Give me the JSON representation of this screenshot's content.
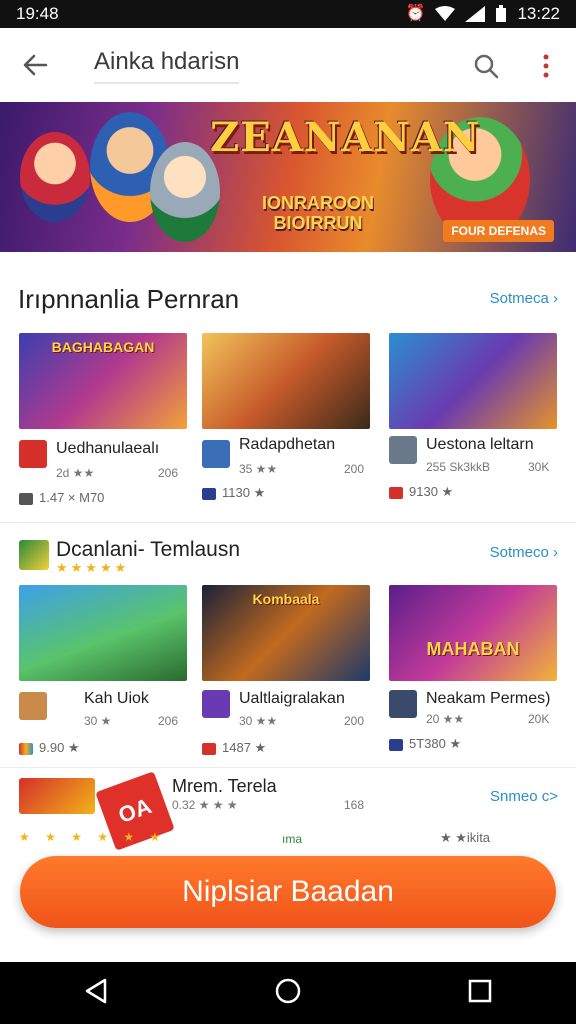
{
  "status_bar": {
    "time": "19:48",
    "right_time": "13:22"
  },
  "app_bar": {
    "title": "Ainka hdarisn"
  },
  "banner": {
    "title": "ZEANANAN",
    "subtitle_line1": "IONRAROON",
    "subtitle_line2": "BIOIRRUN",
    "tag": "FOUR DEFENAS"
  },
  "section1": {
    "title": "Irıpnnanlia Pernran",
    "see_more": "Sotmeca",
    "cards": [
      {
        "banner_text": "BAGHABAGAN",
        "name": "Uedhanulaealı",
        "rating": "2d ★★",
        "downloads": "206",
        "meta": "1.47 × M70"
      },
      {
        "banner_text": "",
        "name": "Radapdhetan",
        "rating": "35 ★★",
        "downloads": "200",
        "meta": "1130 ★"
      },
      {
        "banner_text": "",
        "name": "Uestona leltarn",
        "rating": "255 Sk3kkB",
        "downloads": "30K",
        "meta": "9130 ★"
      }
    ]
  },
  "section2": {
    "title": "Dcanlani- Temlausn",
    "see_more": "Sotmeco",
    "stars": "★★★★★",
    "cards": [
      {
        "banner_text": "",
        "name": "Kah Uiok",
        "rating": "30 ★",
        "downloads": "206",
        "meta": "9.90 ★"
      },
      {
        "banner_text": "Kombaala",
        "name": "Ualtlaigralakan",
        "rating": "30 ★★",
        "downloads": "200",
        "meta": "1487 ★"
      },
      {
        "banner_text": "MAHABAN",
        "name": "Neakam Permes)",
        "rating": "20 ★★",
        "downloads": "20K",
        "meta": "5T380 ★"
      }
    ]
  },
  "section3": {
    "title": "Mrem. Terela",
    "rating": "0.32 ★ ★ ★",
    "downloads": "168",
    "see_more": "Snmeo c>",
    "badge_text": "OA",
    "right_meta": "★ ★ikita",
    "mini_label": "ıma"
  },
  "install_button": {
    "label": "Niplsiar Baadan"
  },
  "colors": {
    "accent": "#f0531a",
    "link": "#2a8fc9"
  }
}
